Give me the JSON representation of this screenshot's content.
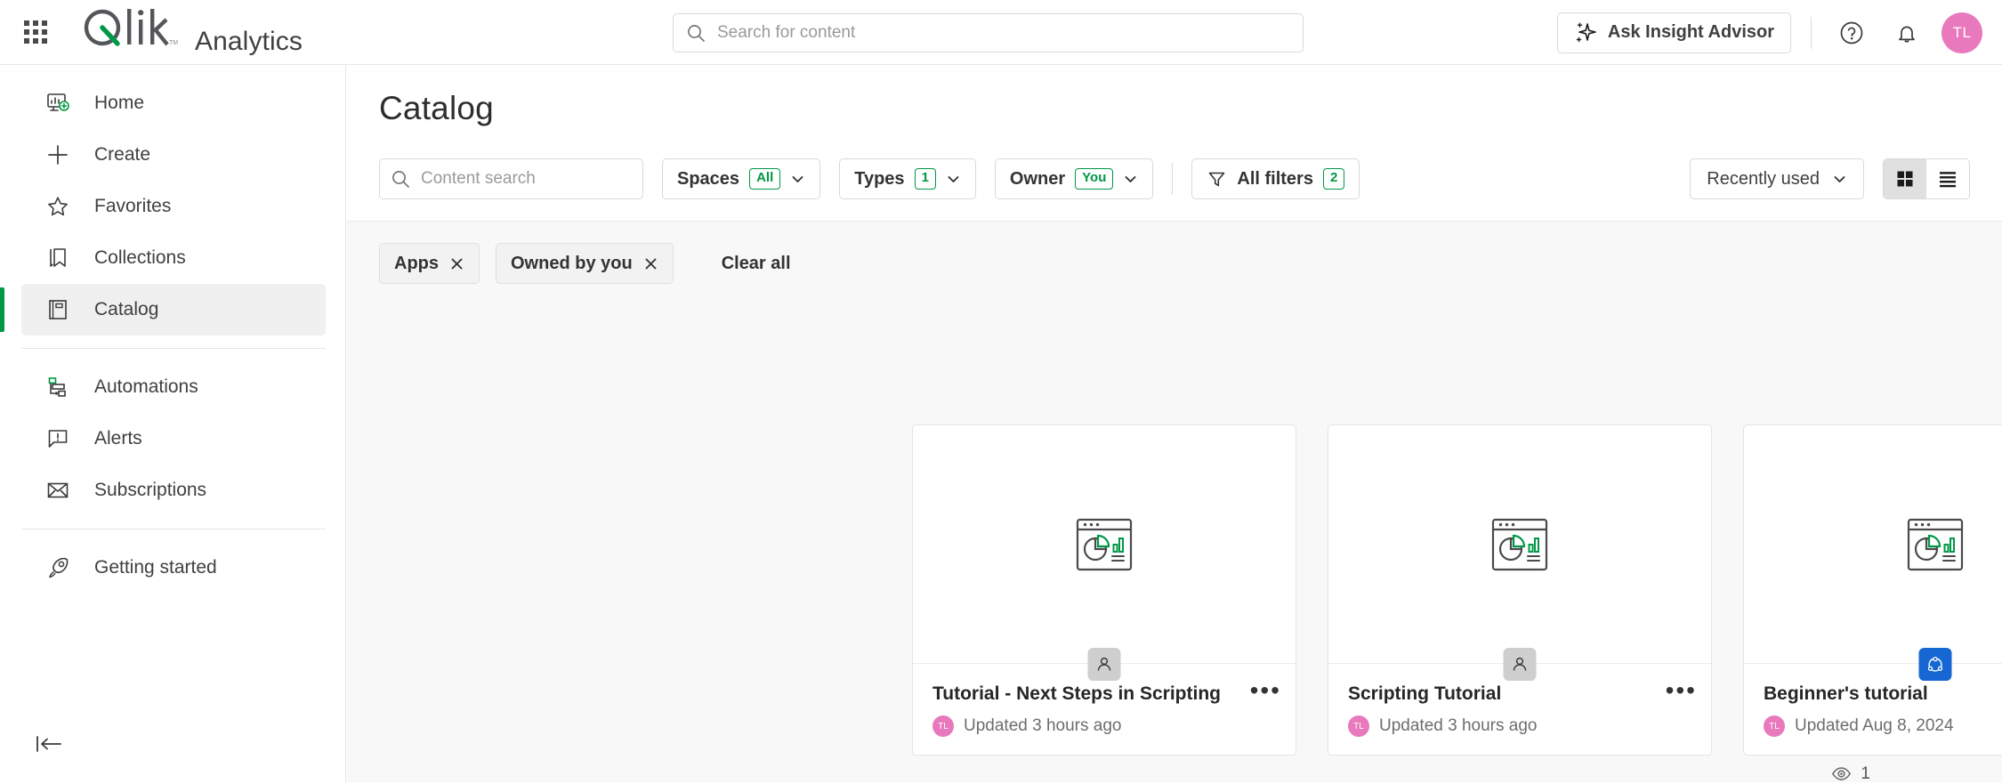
{
  "topbar": {
    "waffle_icon": "app-grid-icon",
    "logo_text": "Qlik",
    "product_name": "Analytics",
    "search": {
      "placeholder": "Search for content",
      "value": "",
      "icon": "search-icon"
    },
    "ask_insight_advisor": "Ask Insight Advisor",
    "help_icon": "help-circle-icon",
    "notifications_icon": "bell-icon",
    "avatar_initials": "TL",
    "avatar_color": "#e979bd"
  },
  "sidebar": {
    "items": [
      {
        "label": "Home",
        "icon": "home-dashboard-icon",
        "active": false
      },
      {
        "label": "Create",
        "icon": "plus-icon",
        "active": false
      },
      {
        "label": "Favorites",
        "icon": "star-outline-icon",
        "active": false
      },
      {
        "label": "Collections",
        "icon": "bookmark-icon",
        "active": false
      },
      {
        "label": "Catalog",
        "icon": "catalog-book-icon",
        "active": true
      },
      {
        "label": "Automations",
        "icon": "automations-flow-icon",
        "active": false
      },
      {
        "label": "Alerts",
        "icon": "alert-speech-bubble-icon",
        "active": false
      },
      {
        "label": "Subscriptions",
        "icon": "envelope-icon",
        "active": false
      },
      {
        "label": "Getting started",
        "icon": "rocket-icon",
        "active": false
      }
    ],
    "collapse_icon": "collapse-panel-icon",
    "active_accent": "#009845"
  },
  "main": {
    "page_title": "Catalog",
    "content_search": {
      "placeholder": "Content search",
      "value": "",
      "icon": "search-icon"
    },
    "filters": [
      {
        "label": "Spaces",
        "badge": "All",
        "icon": "chevron-down-icon"
      },
      {
        "label": "Types",
        "badge": "1",
        "icon": "chevron-down-icon"
      },
      {
        "label": "Owner",
        "badge": "You",
        "icon": "chevron-down-icon"
      }
    ],
    "all_filters": {
      "label": "All filters",
      "badge": "2",
      "icon": "funnel-icon"
    },
    "sort": {
      "label": "Recently used",
      "icon": "chevron-down-icon"
    },
    "view_grid_icon": "grid-view-icon",
    "view_list_icon": "list-view-icon",
    "active_view": "grid",
    "chips": [
      {
        "label": "Apps",
        "remove_icon": "close-icon"
      },
      {
        "label": "Owned by you",
        "remove_icon": "close-icon"
      }
    ],
    "clear_all": "Clear all",
    "view_count": {
      "icon": "eye-icon",
      "value": "1"
    },
    "badge_color": "#009845"
  },
  "cards": [
    {
      "title": "Tutorial - Next Steps in Scripting",
      "updated": "Updated 3 hours ago",
      "owner_initials": "TL",
      "thumb_icon": "app-chart-icon",
      "space_badge": "personal-space-icon",
      "space_badge_type": "personal",
      "favorite": false,
      "kebab_icon": "more-options-icon"
    },
    {
      "title": "Scripting Tutorial",
      "updated": "Updated 3 hours ago",
      "owner_initials": "TL",
      "thumb_icon": "app-chart-icon",
      "space_badge": "personal-space-icon",
      "space_badge_type": "personal",
      "favorite": false,
      "kebab_icon": "more-options-icon"
    },
    {
      "title": "Beginner's tutorial",
      "updated": "Updated Aug 8, 2024",
      "owner_initials": "TL",
      "thumb_icon": "app-chart-icon",
      "space_badge": "shared-space-icon",
      "space_badge_type": "shared",
      "favorite": true,
      "favorite_icon": "star-filled-icon",
      "kebab_icon": "more-options-icon"
    }
  ]
}
